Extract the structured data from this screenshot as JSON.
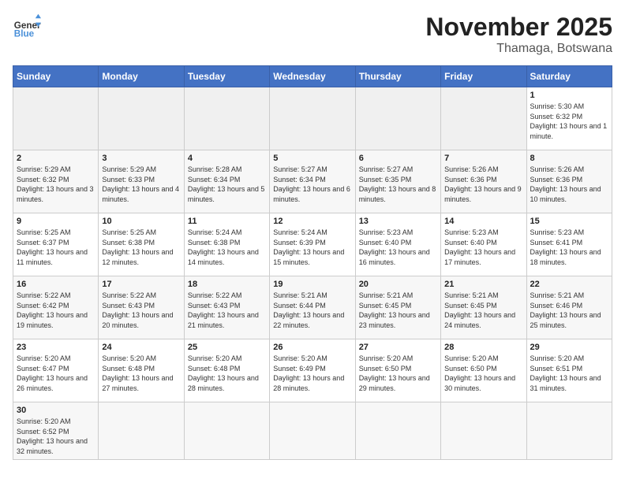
{
  "header": {
    "logo_general": "General",
    "logo_blue": "Blue",
    "month": "November 2025",
    "location": "Thamaga, Botswana"
  },
  "weekdays": [
    "Sunday",
    "Monday",
    "Tuesday",
    "Wednesday",
    "Thursday",
    "Friday",
    "Saturday"
  ],
  "weeks": [
    [
      {
        "day": "",
        "info": ""
      },
      {
        "day": "",
        "info": ""
      },
      {
        "day": "",
        "info": ""
      },
      {
        "day": "",
        "info": ""
      },
      {
        "day": "",
        "info": ""
      },
      {
        "day": "",
        "info": ""
      },
      {
        "day": "1",
        "info": "Sunrise: 5:30 AM\nSunset: 6:32 PM\nDaylight: 13 hours and 1 minute."
      }
    ],
    [
      {
        "day": "2",
        "info": "Sunrise: 5:29 AM\nSunset: 6:32 PM\nDaylight: 13 hours and 3 minutes."
      },
      {
        "day": "3",
        "info": "Sunrise: 5:29 AM\nSunset: 6:33 PM\nDaylight: 13 hours and 4 minutes."
      },
      {
        "day": "4",
        "info": "Sunrise: 5:28 AM\nSunset: 6:34 PM\nDaylight: 13 hours and 5 minutes."
      },
      {
        "day": "5",
        "info": "Sunrise: 5:27 AM\nSunset: 6:34 PM\nDaylight: 13 hours and 6 minutes."
      },
      {
        "day": "6",
        "info": "Sunrise: 5:27 AM\nSunset: 6:35 PM\nDaylight: 13 hours and 8 minutes."
      },
      {
        "day": "7",
        "info": "Sunrise: 5:26 AM\nSunset: 6:36 PM\nDaylight: 13 hours and 9 minutes."
      },
      {
        "day": "8",
        "info": "Sunrise: 5:26 AM\nSunset: 6:36 PM\nDaylight: 13 hours and 10 minutes."
      }
    ],
    [
      {
        "day": "9",
        "info": "Sunrise: 5:25 AM\nSunset: 6:37 PM\nDaylight: 13 hours and 11 minutes."
      },
      {
        "day": "10",
        "info": "Sunrise: 5:25 AM\nSunset: 6:38 PM\nDaylight: 13 hours and 12 minutes."
      },
      {
        "day": "11",
        "info": "Sunrise: 5:24 AM\nSunset: 6:38 PM\nDaylight: 13 hours and 14 minutes."
      },
      {
        "day": "12",
        "info": "Sunrise: 5:24 AM\nSunset: 6:39 PM\nDaylight: 13 hours and 15 minutes."
      },
      {
        "day": "13",
        "info": "Sunrise: 5:23 AM\nSunset: 6:40 PM\nDaylight: 13 hours and 16 minutes."
      },
      {
        "day": "14",
        "info": "Sunrise: 5:23 AM\nSunset: 6:40 PM\nDaylight: 13 hours and 17 minutes."
      },
      {
        "day": "15",
        "info": "Sunrise: 5:23 AM\nSunset: 6:41 PM\nDaylight: 13 hours and 18 minutes."
      }
    ],
    [
      {
        "day": "16",
        "info": "Sunrise: 5:22 AM\nSunset: 6:42 PM\nDaylight: 13 hours and 19 minutes."
      },
      {
        "day": "17",
        "info": "Sunrise: 5:22 AM\nSunset: 6:43 PM\nDaylight: 13 hours and 20 minutes."
      },
      {
        "day": "18",
        "info": "Sunrise: 5:22 AM\nSunset: 6:43 PM\nDaylight: 13 hours and 21 minutes."
      },
      {
        "day": "19",
        "info": "Sunrise: 5:21 AM\nSunset: 6:44 PM\nDaylight: 13 hours and 22 minutes."
      },
      {
        "day": "20",
        "info": "Sunrise: 5:21 AM\nSunset: 6:45 PM\nDaylight: 13 hours and 23 minutes."
      },
      {
        "day": "21",
        "info": "Sunrise: 5:21 AM\nSunset: 6:45 PM\nDaylight: 13 hours and 24 minutes."
      },
      {
        "day": "22",
        "info": "Sunrise: 5:21 AM\nSunset: 6:46 PM\nDaylight: 13 hours and 25 minutes."
      }
    ],
    [
      {
        "day": "23",
        "info": "Sunrise: 5:20 AM\nSunset: 6:47 PM\nDaylight: 13 hours and 26 minutes."
      },
      {
        "day": "24",
        "info": "Sunrise: 5:20 AM\nSunset: 6:48 PM\nDaylight: 13 hours and 27 minutes."
      },
      {
        "day": "25",
        "info": "Sunrise: 5:20 AM\nSunset: 6:48 PM\nDaylight: 13 hours and 28 minutes."
      },
      {
        "day": "26",
        "info": "Sunrise: 5:20 AM\nSunset: 6:49 PM\nDaylight: 13 hours and 28 minutes."
      },
      {
        "day": "27",
        "info": "Sunrise: 5:20 AM\nSunset: 6:50 PM\nDaylight: 13 hours and 29 minutes."
      },
      {
        "day": "28",
        "info": "Sunrise: 5:20 AM\nSunset: 6:50 PM\nDaylight: 13 hours and 30 minutes."
      },
      {
        "day": "29",
        "info": "Sunrise: 5:20 AM\nSunset: 6:51 PM\nDaylight: 13 hours and 31 minutes."
      }
    ],
    [
      {
        "day": "30",
        "info": "Sunrise: 5:20 AM\nSunset: 6:52 PM\nDaylight: 13 hours and 32 minutes."
      },
      {
        "day": "",
        "info": ""
      },
      {
        "day": "",
        "info": ""
      },
      {
        "day": "",
        "info": ""
      },
      {
        "day": "",
        "info": ""
      },
      {
        "day": "",
        "info": ""
      },
      {
        "day": "",
        "info": ""
      }
    ]
  ]
}
